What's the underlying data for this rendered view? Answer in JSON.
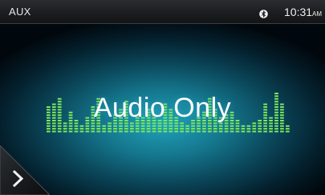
{
  "status_bar": {
    "source": "AUX",
    "time": "10:31",
    "ampm": "AM",
    "bluetooth_icon": "bluetooth-icon"
  },
  "main": {
    "message": "Audio Only",
    "equalizer_bar_heights": [
      10,
      11,
      13,
      4,
      8,
      5,
      3,
      6,
      10,
      13,
      3,
      4,
      7,
      9,
      12,
      4,
      7,
      6,
      9,
      7,
      5,
      11,
      9,
      6,
      4,
      3,
      5,
      6,
      8,
      13,
      9,
      6,
      7,
      8,
      5,
      3,
      3,
      4,
      5,
      11,
      6,
      15,
      11,
      3
    ],
    "equalizer_colors": [
      "#3ee06a",
      "#b8f050"
    ]
  },
  "navigation": {
    "next_icon": "chevron-right-icon"
  }
}
